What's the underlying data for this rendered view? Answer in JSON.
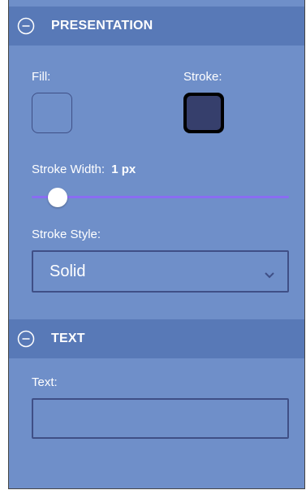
{
  "presentation": {
    "title": "PRESENTATION",
    "fill_label": "Fill:",
    "stroke_label": "Stroke:",
    "fill_color": "#6f8fc9",
    "stroke_color": "#363f6c",
    "stroke_width_label": "Stroke Width:",
    "stroke_width_value": "1 px",
    "stroke_width_slider_fraction": 0.04,
    "stroke_style_label": "Stroke Style:",
    "stroke_style_selected": "Solid"
  },
  "text_section": {
    "title": "TEXT",
    "text_label": "Text:",
    "text_value": ""
  },
  "icons": {
    "collapse": "minus-circle-icon",
    "dropdown": "chevron-down-icon"
  }
}
